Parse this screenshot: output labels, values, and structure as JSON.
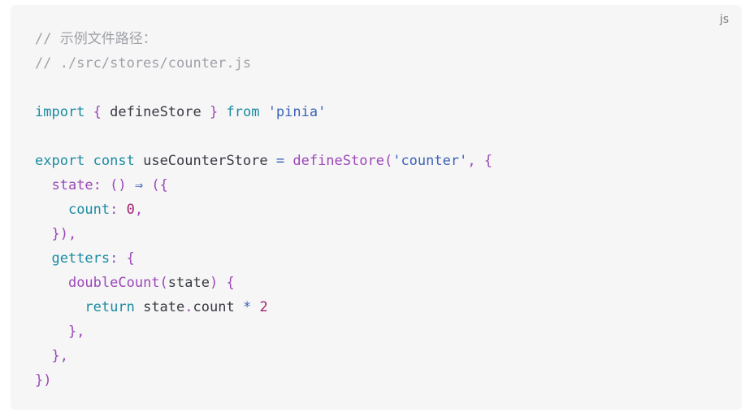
{
  "code_block": {
    "language": "js",
    "lines": [
      [
        {
          "t": "// 示例文件路径：",
          "c": "cm"
        }
      ],
      [
        {
          "t": "// ./src/stores/counter.js",
          "c": "cm"
        }
      ],
      [],
      [
        {
          "t": "import",
          "c": "kw"
        },
        {
          "t": " ",
          "c": "var"
        },
        {
          "t": "{",
          "c": "pu"
        },
        {
          "t": " defineStore ",
          "c": "var"
        },
        {
          "t": "}",
          "c": "pu"
        },
        {
          "t": " ",
          "c": "var"
        },
        {
          "t": "from",
          "c": "kw"
        },
        {
          "t": " ",
          "c": "var"
        },
        {
          "t": "'pinia'",
          "c": "str"
        }
      ],
      [],
      [
        {
          "t": "export",
          "c": "kw"
        },
        {
          "t": " ",
          "c": "var"
        },
        {
          "t": "const",
          "c": "kw"
        },
        {
          "t": " useCounterStore ",
          "c": "var"
        },
        {
          "t": "=",
          "c": "op"
        },
        {
          "t": " ",
          "c": "var"
        },
        {
          "t": "defineStore",
          "c": "fn"
        },
        {
          "t": "(",
          "c": "pu"
        },
        {
          "t": "'counter'",
          "c": "str"
        },
        {
          "t": ",",
          "c": "pu"
        },
        {
          "t": " ",
          "c": "var"
        },
        {
          "t": "{",
          "c": "pu"
        }
      ],
      [
        {
          "t": "  ",
          "c": "var"
        },
        {
          "t": "state",
          "c": "fn"
        },
        {
          "t": ":",
          "c": "pu"
        },
        {
          "t": " ",
          "c": "var"
        },
        {
          "t": "()",
          "c": "pu"
        },
        {
          "t": " ",
          "c": "var"
        },
        {
          "t": "⇒",
          "c": "op"
        },
        {
          "t": " ",
          "c": "var"
        },
        {
          "t": "({",
          "c": "pu"
        }
      ],
      [
        {
          "t": "    ",
          "c": "var"
        },
        {
          "t": "count",
          "c": "prop"
        },
        {
          "t": ":",
          "c": "pu"
        },
        {
          "t": " ",
          "c": "var"
        },
        {
          "t": "0",
          "c": "num"
        },
        {
          "t": ",",
          "c": "pu"
        }
      ],
      [
        {
          "t": "  ",
          "c": "var"
        },
        {
          "t": "}),",
          "c": "pu"
        }
      ],
      [
        {
          "t": "  ",
          "c": "var"
        },
        {
          "t": "getters",
          "c": "prop"
        },
        {
          "t": ":",
          "c": "pu"
        },
        {
          "t": " ",
          "c": "var"
        },
        {
          "t": "{",
          "c": "pu"
        }
      ],
      [
        {
          "t": "    ",
          "c": "var"
        },
        {
          "t": "doubleCount",
          "c": "fn"
        },
        {
          "t": "(",
          "c": "pu"
        },
        {
          "t": "state",
          "c": "var"
        },
        {
          "t": ")",
          "c": "pu"
        },
        {
          "t": " ",
          "c": "var"
        },
        {
          "t": "{",
          "c": "pu"
        }
      ],
      [
        {
          "t": "      ",
          "c": "var"
        },
        {
          "t": "return",
          "c": "kw"
        },
        {
          "t": " state",
          "c": "var"
        },
        {
          "t": ".",
          "c": "pu"
        },
        {
          "t": "count ",
          "c": "var"
        },
        {
          "t": "*",
          "c": "op"
        },
        {
          "t": " ",
          "c": "var"
        },
        {
          "t": "2",
          "c": "num"
        }
      ],
      [
        {
          "t": "    ",
          "c": "var"
        },
        {
          "t": "},",
          "c": "pu"
        }
      ],
      [
        {
          "t": "  ",
          "c": "var"
        },
        {
          "t": "},",
          "c": "pu"
        }
      ],
      [
        {
          "t": "})",
          "c": "pu"
        }
      ]
    ]
  }
}
